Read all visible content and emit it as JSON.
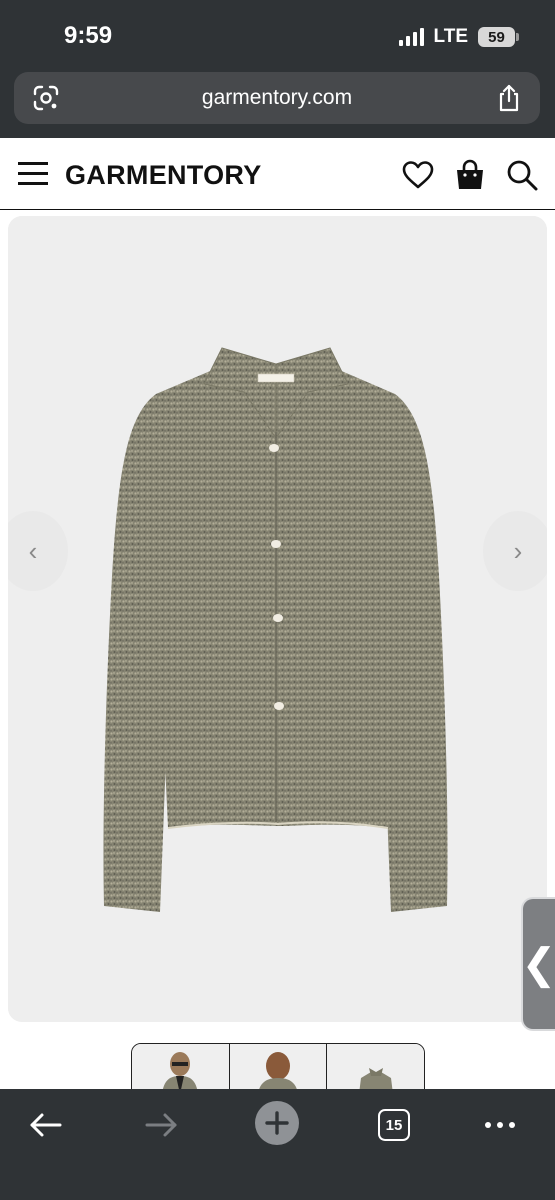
{
  "status_bar": {
    "time": "9:59",
    "network": "LTE",
    "battery": "59"
  },
  "browser": {
    "url": "garmentory.com",
    "open_tabs": "15",
    "left_icon": "google-lens-icon",
    "right_icon": "share-icon"
  },
  "site": {
    "brand": "GARMENTORY",
    "menu_icon": "hamburger-icon",
    "wishlist_icon": "heart-icon",
    "cart_icon": "shopping-bag-icon",
    "search_icon": "search-icon"
  },
  "gallery": {
    "product_image": "grey boucle knit shirt jacket",
    "prev_label": "‹",
    "next_label": "›",
    "thumbnails": [
      "model front view",
      "model back view",
      "flat product view"
    ]
  },
  "side_tab": {
    "label": "❮"
  },
  "colors": {
    "chrome_dark": "#2f3336",
    "urlbar": "#47494c",
    "garment_base": "#878573",
    "image_bg": "#eeeeee"
  }
}
